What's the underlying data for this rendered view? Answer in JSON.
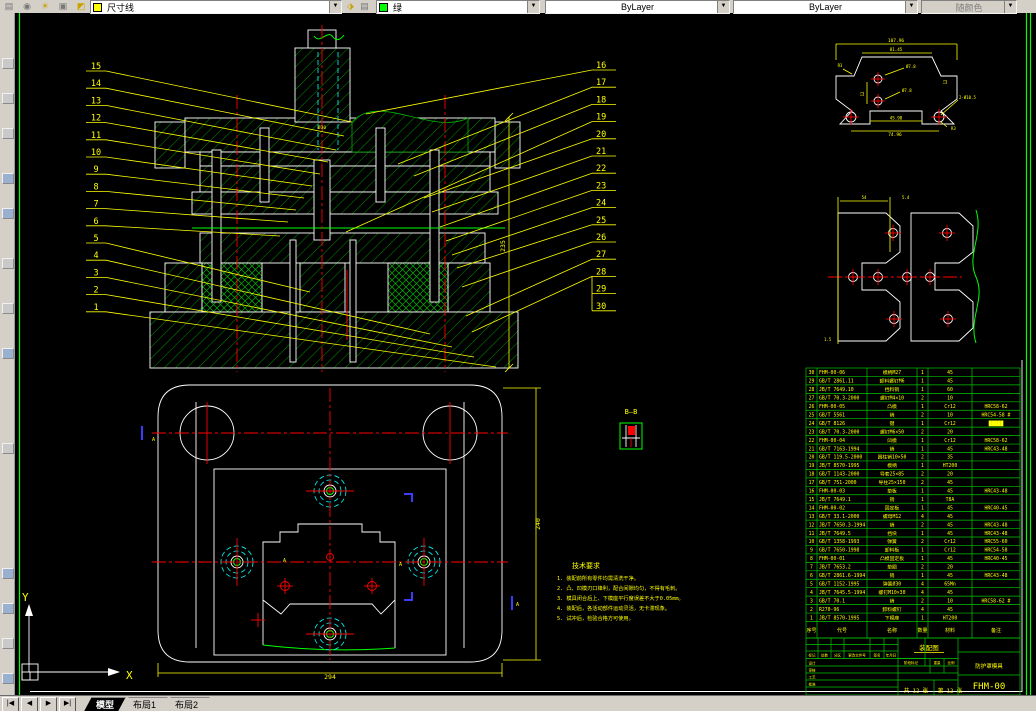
{
  "toolbar": {
    "layer_field": {
      "label": "尺寸线",
      "swatch": "#ffff00"
    },
    "color_field": {
      "label": "绿",
      "swatch": "#00ff00"
    },
    "linetype_field": "ByLayer",
    "lineweight_field": "ByLayer",
    "plot_style_field": "随颜色",
    "icons": [
      "layers-stack",
      "layer-state",
      "sun",
      "layer-freeze",
      "layer-color",
      "make-object-layer-current",
      "layer-previous"
    ]
  },
  "tabs": {
    "nav": [
      "|◀",
      "◀",
      "▶",
      "▶|"
    ],
    "items": [
      "模型",
      "布局1",
      "布局2"
    ],
    "active": "模型"
  },
  "drawing": {
    "callouts": {
      "left": [
        "15",
        "14",
        "13",
        "12",
        "11",
        "10",
        "9",
        "8",
        "7",
        "6",
        "5",
        "4",
        "3",
        "2",
        "1"
      ],
      "right": [
        "16",
        "17",
        "18",
        "19",
        "20",
        "21",
        "22",
        "23",
        "24",
        "25",
        "26",
        "27",
        "28",
        "29",
        "30"
      ]
    },
    "dims": {
      "section_height": "235",
      "shank_dia": "Ø30",
      "plan_width": "294",
      "plan_height": "240",
      "section_label": "B—B",
      "detail": {
        "total_width": "107.96",
        "inner_width": "81.45",
        "hole_a": "Ø7.8",
        "hole_b": "Ø7.8",
        "corner_holes": "2-Ø10.5",
        "slot_width": "45.98",
        "bottom_width": "74.96",
        "radius_tl": "R3",
        "radius_br": "R3",
        "height_right": "12",
        "height_left": "12"
      },
      "strip": {
        "pitch": "54",
        "step": "5.4",
        "margin": "1.5"
      }
    },
    "plan_section_marks": [
      "A",
      "A",
      "A",
      "A"
    ],
    "notes": {
      "title": "技术要求",
      "items": [
        "1. 装配前所有零件均需清洗干净。",
        "2. 凸、凹模刃口锋利，配合间隙均匀，不得有毛刺。",
        "3. 模具闭合后上、下模座平行度误差不大于0.05mm。",
        "4. 装配后，各活动部件运动灵活，无卡滞现象。",
        "5. 试冲后，检验合格方可使用。"
      ]
    },
    "parts_table": {
      "header": [
        "序号",
        "代号",
        "名称",
        "数量",
        "材料",
        "备注"
      ],
      "rows": [
        [
          "30",
          "FHM-00-06",
          "模柄M27",
          "1",
          "45",
          ""
        ],
        [
          "29",
          "GB/T 2861.11",
          "卸料螺钉M6",
          "1",
          "45",
          ""
        ],
        [
          "28",
          "JB/T 7649.10",
          "挡料销",
          "1",
          "60",
          ""
        ],
        [
          "27",
          "GB/T 70.3-2000",
          "螺钉M4×10",
          "2",
          "10",
          ""
        ],
        [
          "26",
          "FHM-00-05",
          "凸模",
          "1",
          "Cr12",
          "HRC58-62"
        ],
        [
          "25",
          "GB/T 5561",
          "销",
          "2",
          "10",
          "HRC54-58 #"
        ],
        [
          "24",
          "GB/T 8126",
          "键",
          "1",
          "Cr12",
          "█████"
        ],
        [
          "23",
          "GB/T 70.3-2000",
          "螺钉M6×50",
          "2",
          "20",
          ""
        ],
        [
          "22",
          "FHM-00-04",
          "凹模",
          "1",
          "Cr12",
          "HRC58-62"
        ],
        [
          "21",
          "GB/T 7163-1994",
          "销",
          "1",
          "45",
          "HRC43-48"
        ],
        [
          "20",
          "GB/T 119.5-2000",
          "圆柱销10×50",
          "2",
          "35",
          ""
        ],
        [
          "19",
          "JB/T 8570-1995",
          "模柄",
          "1",
          "HT200",
          ""
        ],
        [
          "18",
          "GB/T 1143-2000",
          "导套25×85",
          "2",
          "20",
          ""
        ],
        [
          "17",
          "GB/T 751-2000",
          "导柱25×150",
          "2",
          "45",
          ""
        ],
        [
          "16",
          "FHM-00-03",
          "垫板",
          "1",
          "45",
          "HRC43-48"
        ],
        [
          "15",
          "JB/T 7649.1",
          "销",
          "1",
          "T8A",
          ""
        ],
        [
          "14",
          "FHM-00-02",
          "固定板",
          "1",
          "45",
          "HRC40-45"
        ],
        [
          "13",
          "GB/T 33.1-2000",
          "螺母M12",
          "4",
          "45",
          ""
        ],
        [
          "12",
          "JB/T 7650.3-1994",
          "销",
          "2",
          "45",
          "HRC43-48"
        ],
        [
          "11",
          "JB/T 7649.5",
          "挡块",
          "1",
          "45",
          "HRC43-48"
        ],
        [
          "10",
          "GB/T 1358-1993",
          "弹簧",
          "2",
          "Cr12",
          "HRC55-60"
        ],
        [
          "9",
          "GB/T 7650-1998",
          "卸料板",
          "1",
          "Cr12",
          "HRC54-58"
        ],
        [
          "8",
          "FHM-00-01",
          "凸模固定板",
          "1",
          "45",
          "HRC40-45"
        ],
        [
          "7",
          "JB/T 7653.2",
          "垫圈",
          "2",
          "20",
          ""
        ],
        [
          "6",
          "GB/T 2861.6-1994",
          "销",
          "1",
          "45",
          "HRC43-48"
        ],
        [
          "5",
          "GB/T 1152-1995",
          "弹簧Ø30",
          "4",
          "65Mn",
          ""
        ],
        [
          "4",
          "JB/T 7645.5-1994",
          "螺钉M10×30",
          "4",
          "45",
          ""
        ],
        [
          "3",
          "GB/T 70.1",
          "销",
          "2",
          "10",
          "HRC58-62 #"
        ],
        [
          "2",
          "R270-96",
          "卸料螺钉",
          "4",
          "45",
          ""
        ],
        [
          "1",
          "JB/T 8570-1995",
          "下模座",
          "1",
          "HT200",
          ""
        ]
      ]
    },
    "title_block": {
      "doc_type": "装配图",
      "product": "防护罩模具",
      "drawing_no": "FHM-00",
      "sheet_total": "共 12 张",
      "sheet_no": "第 12 张",
      "small_labels": [
        "标记",
        "处数",
        "分区",
        "更改文件号",
        "签名",
        "年月日",
        "设计",
        "审核",
        "工艺",
        "批准",
        "阶段标记",
        "重量",
        "比例"
      ]
    },
    "ucs": {
      "x_label": "X",
      "y_label": "Y"
    }
  }
}
